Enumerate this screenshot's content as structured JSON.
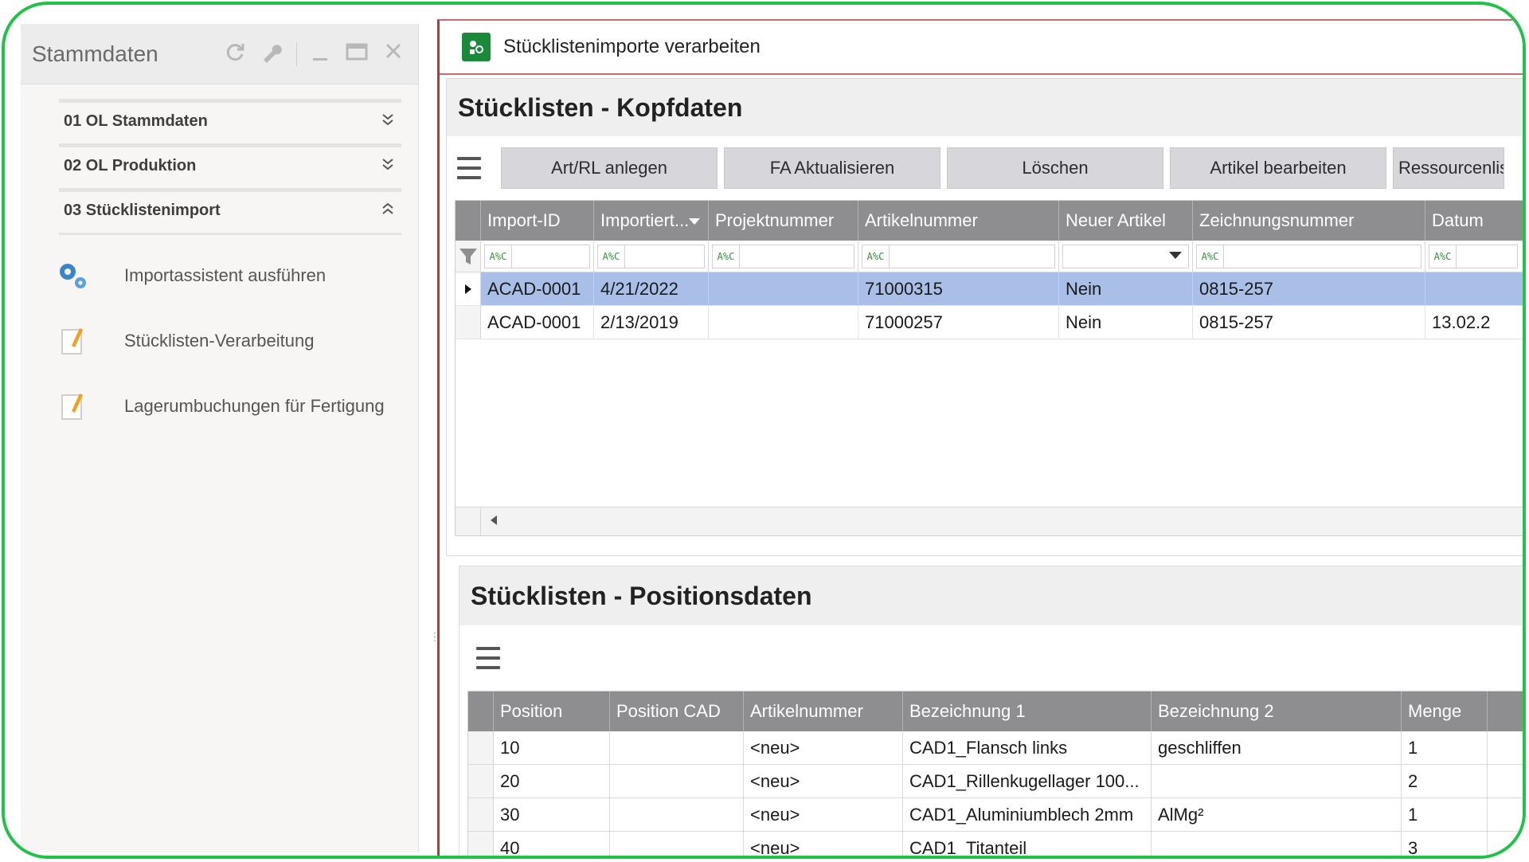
{
  "left_panel": {
    "title": "Stammdaten",
    "header_icons": [
      "refresh-icon",
      "wrench-icon",
      "minimize-icon",
      "maximize-icon",
      "close-icon"
    ],
    "accordion": [
      {
        "label": "01 OL Stammdaten",
        "state": "collapsed"
      },
      {
        "label": "02 OL Produktion",
        "state": "collapsed"
      },
      {
        "label": "03 Stücklistenimport",
        "state": "expanded"
      }
    ],
    "nav_items": [
      {
        "label": "Importassistent ausführen",
        "icon": "gears-icon"
      },
      {
        "label": "Stücklisten-Verarbeitung",
        "icon": "edit-note-icon"
      },
      {
        "label": "Lagerumbuchungen für Fertigung",
        "icon": "edit-note-icon"
      }
    ]
  },
  "window": {
    "title": "Stücklistenimporte verarbeiten",
    "icon": "app-icon"
  },
  "kopfdaten": {
    "title": "Stücklisten - Kopfdaten",
    "toolbar": [
      "Art/RL anlegen",
      "FA Aktualisieren",
      "Löschen",
      "Artikel bearbeiten",
      "Ressourcenlis"
    ],
    "columns": [
      "Import-ID",
      "Importiert...",
      "Projektnummer",
      "Artikelnummer",
      "Neuer Artikel",
      "Zeichnungsnummer",
      "Datum"
    ],
    "filter_code": "A%C",
    "rows": [
      [
        "ACAD-0001",
        "4/21/2022",
        "",
        "71000315",
        "Nein",
        "0815-257",
        ""
      ],
      [
        "ACAD-0001",
        "2/13/2019",
        "",
        "71000257",
        "Nein",
        "0815-257",
        "13.02.2"
      ]
    ],
    "selected_row": 0
  },
  "positionsdaten": {
    "title": "Stücklisten - Positionsdaten",
    "columns": [
      "Position",
      "Position CAD",
      "Artikelnummer",
      "Bezeichnung 1",
      "Bezeichnung 2",
      "Menge",
      ""
    ],
    "rows": [
      [
        "10",
        "",
        "<neu>",
        "CAD1_Flansch links",
        "geschliffen",
        "1",
        ""
      ],
      [
        "20",
        "",
        "<neu>",
        "CAD1_Rillenkugellager 100...",
        "",
        "2",
        ""
      ],
      [
        "30",
        "",
        "<neu>",
        "CAD1_Aluminiumblech 2mm",
        "AlMg²",
        "1",
        ""
      ],
      [
        "40",
        "",
        "<neu>",
        "CAD1_Titanteil",
        "",
        "3",
        ""
      ]
    ]
  }
}
